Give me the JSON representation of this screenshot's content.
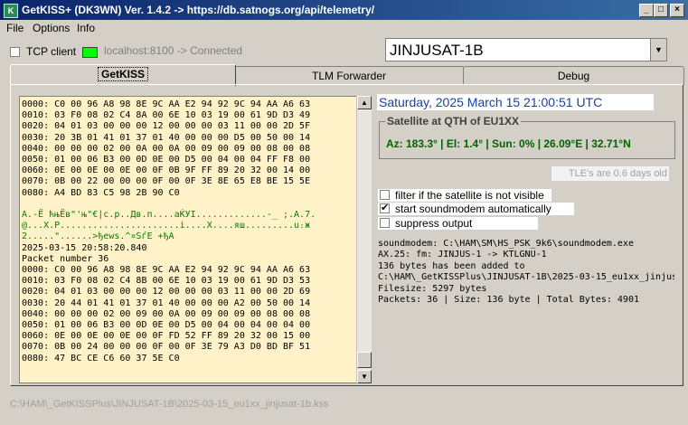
{
  "window": {
    "title": "GetKISS+ (DK3WN) Ver. 1.4.2 -> https://db.satnogs.org/api/telemetry/",
    "icon": "kiss-app-icon",
    "controls": [
      "_",
      "□",
      "×"
    ]
  },
  "menu": {
    "file": "File",
    "options": "Options",
    "info": "Info"
  },
  "toolbar": {
    "tcp_client_label": "TCP client",
    "tcp_client_checked": false,
    "connection_status": "localhost:8100 -> Connected",
    "status_color": "#00ff00"
  },
  "satellite_select": {
    "value": "JINJUSAT-1B"
  },
  "tabs": [
    {
      "label": "GetKISS",
      "active": true
    },
    {
      "label": "TLM Forwarder",
      "active": false
    },
    {
      "label": "Debug",
      "active": false
    }
  ],
  "hex_dump": {
    "block1": [
      "0000: C0 00 96 A8 98 8E 9C AA E2 94 92 9C 94 AA A6 63",
      "0010: 03 F0 08 02 C4 8A 00 6E 10 03 19 00 61 9D D3 49",
      "0020: 04 01 03 00 00 00 12 00 00 00 03 11 00 00 2D 5F",
      "0030: 20 3B 01 41 01 37 01 40 00 00 00 D5 00 50 00 14",
      "0040: 00 00 00 02 00 0A 00 0A 00 09 00 09 00 08 00 08",
      "0050: 01 00 06 B3 00 0D 0E 00 D5 00 04 00 04 FF F8 00",
      "0060: 0E 00 0E 00 0E 00 0F 0B 9F FF 89 20 32 00 14 00",
      "0070: 0B 00 22 00 00 00 0F 00 0F 3E 8E 65 E8 BE 15 5E",
      "0080: A4 BD 83 C5 98 2B 90 C0"
    ],
    "ascii1": [
      "А.-Ё ћњЁв\"'њ\"€|с.р..Дв.п....аЌУI.............-_ ;.A.7.",
      "@...X.P......................i....X....яш.........ս։ж",
      "2.....\"......>ђеws.^¤SѓЕ +ђA"
    ],
    "timestamp": "2025-03-15 20:58:20.840",
    "packet_label": "Packet number 36",
    "block2": [
      "0000: C0 00 96 A8 98 8E 9C AA E2 94 92 9C 94 AA A6 63",
      "0010: 03 F0 08 02 C4 8B 00 6E 10 03 19 00 61 9D D3 53",
      "0020: 04 01 03 00 00 00 12 00 00 00 03 11 00 00 2D 69",
      "0030: 20 44 01 41 01 37 01 40 00 00 00 A2 00 50 00 14",
      "0040: 00 00 00 02 00 09 00 0A 00 09 00 09 00 08 00 08",
      "0050: 01 00 06 B3 00 0D 0E 00 D5 00 04 00 04 00 04 00",
      "0060: 0E 00 0E 00 0E 00 0F FD 52 FF 89 20 32 00 15 00",
      "0070: 0B 00 24 00 00 00 0F 00 0F 3E 79 A3 D0 BD BF 51",
      "0080: 47 BC CE C6 60 37 5E C0"
    ]
  },
  "right_panel": {
    "datetime": "Saturday, 2025 March 15  21:00:51 UTC",
    "group_title": "Satellite at QTH of EU1XX",
    "sat_info": "Az: 183.3° | El: 1.4° | Sun: 0% | 26.09°E | 32.71°N",
    "tle_age": "TLE's are 0.6 days old",
    "options": [
      {
        "label": "filter if the satellite is not visible",
        "checked": false
      },
      {
        "label": "start soundmodem automatically",
        "checked": true
      },
      {
        "label": "suppress output",
        "checked": false
      }
    ],
    "log": [
      "soundmodem: C:\\HAM\\SM\\HS_PSK_9k6\\soundmodem.exe",
      "AX.25: fm: JINJUS-1 -> KTLGNU-1",
      "136 bytes has been added to",
      "C:\\HAM\\_GetKISSPlus\\JINJUSAT-1B\\2025-03-15_eu1xx_jinjus",
      "Filesize: 5297 bytes",
      "Packets: 36 | Size: 136 byte | Total Bytes: 4901"
    ]
  },
  "statusbar": {
    "path": "C:\\HAM\\_GetKISSPlus\\JINJUSAT-1B\\2025-03-15_eu1xx_jinjusat-1b.kss"
  },
  "colors": {
    "titlebar": "#0a246a",
    "hex_background": "#fff2c8",
    "ascii_text": "#008000",
    "sat_info": "#006400",
    "datetime": "#1a3fa0"
  }
}
